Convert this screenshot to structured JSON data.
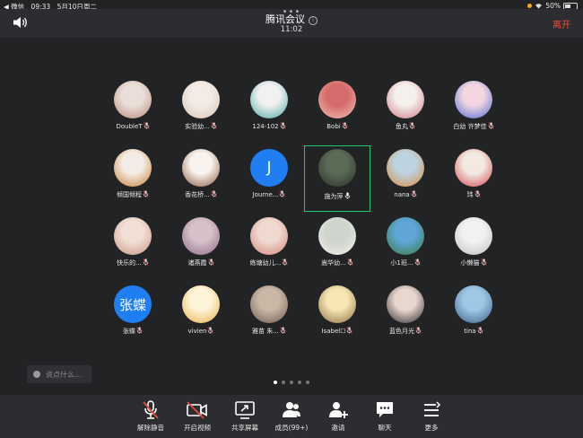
{
  "status_bar": {
    "carrier": "◀ 微信",
    "time": "09:33",
    "date": "5月10日周二",
    "battery": "50%",
    "battery_level": 0.5
  },
  "header": {
    "title": "腾讯会议",
    "timer": "11:02",
    "leave_label": "离开"
  },
  "participants": [
    {
      "name": "DoubleT",
      "avatar": {
        "type": "photo",
        "colors": [
          "#eadfd8",
          "#b98a7b"
        ]
      }
    },
    {
      "name": "实验幼...",
      "avatar": {
        "type": "photo",
        "colors": [
          "#f3ece6",
          "#d7c3b4"
        ]
      }
    },
    {
      "name": "124-102",
      "avatar": {
        "type": "photo",
        "colors": [
          "#f1f1f1",
          "#4aa7a5"
        ]
      }
    },
    {
      "name": "Bobi",
      "avatar": {
        "type": "photo",
        "colors": [
          "#d56b6b",
          "#f0c1b0"
        ]
      }
    },
    {
      "name": "鱼丸",
      "avatar": {
        "type": "photo",
        "colors": [
          "#f4f0ec",
          "#d07a82"
        ]
      }
    },
    {
      "name": "白幼 许梦佳",
      "avatar": {
        "type": "photo",
        "colors": [
          "#f3d6e0",
          "#4a6bd0"
        ]
      }
    },
    {
      "name": "倾国倾程",
      "avatar": {
        "type": "photo",
        "colors": [
          "#f4ede5",
          "#c27b32"
        ]
      }
    },
    {
      "name": "香花桥...",
      "avatar": {
        "type": "photo",
        "colors": [
          "#f8f3ee",
          "#8b5a3e"
        ]
      }
    },
    {
      "name": "Journe...",
      "avatar": {
        "type": "letter",
        "text": "J",
        "bg": "#1f7ef2"
      }
    },
    {
      "name": "施为萍",
      "avatar": {
        "type": "photo",
        "colors": [
          "#5b6b56",
          "#283127"
        ]
      },
      "speaking": true
    },
    {
      "name": "nana",
      "avatar": {
        "type": "photo",
        "colors": [
          "#bdd3e0",
          "#d8893d"
        ]
      }
    },
    {
      "name": "玮",
      "avatar": {
        "type": "photo",
        "colors": [
          "#f2eae2",
          "#d3474d"
        ]
      }
    },
    {
      "name": "快乐的...",
      "avatar": {
        "type": "photo",
        "colors": [
          "#f2dfd6",
          "#c79380"
        ]
      }
    },
    {
      "name": "诸燕霞",
      "avatar": {
        "type": "photo",
        "colors": [
          "#d8c0c8",
          "#8b6a88"
        ]
      }
    },
    {
      "name": "练塘幼儿...",
      "avatar": {
        "type": "photo",
        "colors": [
          "#f0d9cf",
          "#d4837a"
        ]
      }
    },
    {
      "name": "嵩华幼...",
      "avatar": {
        "type": "photo",
        "colors": [
          "#cfd4cc",
          "#f0efeb"
        ]
      }
    },
    {
      "name": "小1班...",
      "avatar": {
        "type": "photo",
        "colors": [
          "#5fa5d8",
          "#3b7b3c"
        ]
      }
    },
    {
      "name": "小懒猫",
      "avatar": {
        "type": "photo",
        "colors": [
          "#f2f2f2",
          "#bfbfbf"
        ]
      }
    },
    {
      "name": "张蝶",
      "avatar": {
        "type": "letter",
        "text": "张蝶",
        "bg": "#1f7ef2"
      }
    },
    {
      "name": "vivien",
      "avatar": {
        "type": "photo",
        "colors": [
          "#fff4d8",
          "#e5b148"
        ]
      }
    },
    {
      "name": "雅苗 朱...",
      "avatar": {
        "type": "photo",
        "colors": [
          "#cbb7a5",
          "#6d5b50"
        ]
      }
    },
    {
      "name": "Isabel☐",
      "avatar": {
        "type": "photo",
        "colors": [
          "#f7e7b5",
          "#8c6b3d"
        ]
      }
    },
    {
      "name": "蓝色月光",
      "avatar": {
        "type": "photo",
        "colors": [
          "#e7d7cf",
          "#2e2a2b"
        ]
      }
    },
    {
      "name": "tina",
      "avatar": {
        "type": "photo",
        "colors": [
          "#9fc7e6",
          "#3a5f87"
        ]
      }
    }
  ],
  "chat": {
    "placeholder": "说点什么..."
  },
  "pager": {
    "count": 5,
    "active": 0
  },
  "toolbar": [
    {
      "label": "解除静音",
      "icon": "mic-off-icon"
    },
    {
      "label": "开启视频",
      "icon": "video-off-icon"
    },
    {
      "label": "共享屏幕",
      "icon": "share-screen-icon"
    },
    {
      "label": "成员(99+)",
      "icon": "members-icon"
    },
    {
      "label": "邀请",
      "icon": "invite-icon"
    },
    {
      "label": "聊天",
      "icon": "chat-icon"
    },
    {
      "label": "更多",
      "icon": "more-icon"
    }
  ]
}
